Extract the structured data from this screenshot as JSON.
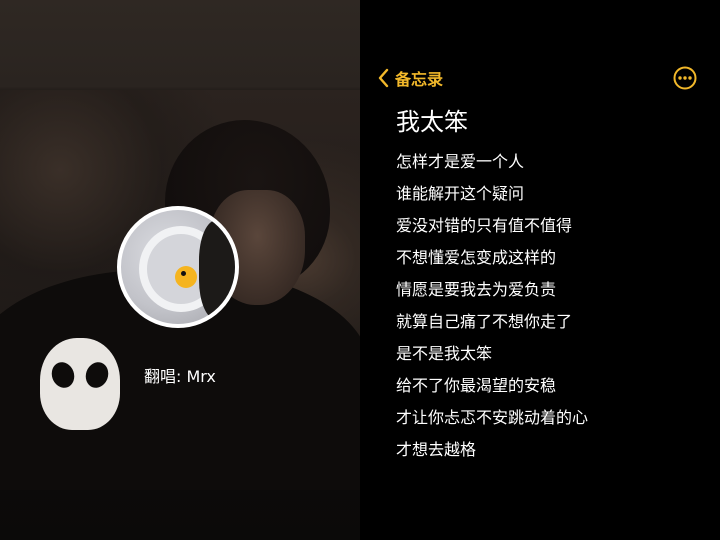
{
  "photo": {
    "singer_label": "翻唱: Mrx"
  },
  "notes": {
    "back_label": "备忘录",
    "back_icon": "chevron-left-icon",
    "more_icon": "ellipsis-circle-icon",
    "accent_color": "#f2b82a",
    "title": "我太笨",
    "lines": [
      "怎样才是爱一个人",
      "谁能解开这个疑问",
      "爱没对错的只有值不值得",
      "不想懂爱怎变成这样的",
      "情愿是要我去为爱负责",
      "就算自己痛了不想你走了",
      "是不是我太笨",
      "给不了你最渴望的安稳",
      "才让你忐忑不安跳动着的心",
      "才想去越格"
    ]
  }
}
